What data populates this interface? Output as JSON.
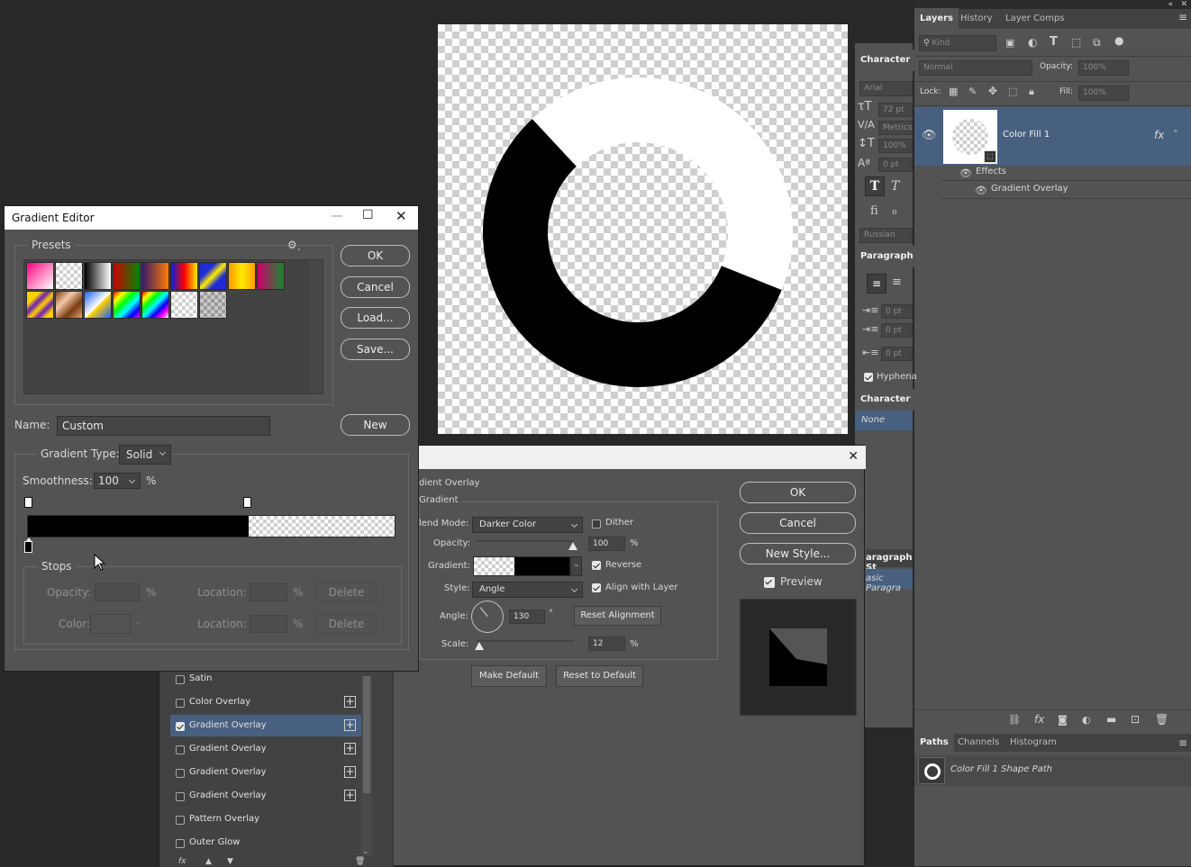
{
  "document": {
    "canvas_label": "canvas"
  },
  "layers_panel": {
    "tabs": [
      "Layers",
      "History",
      "Layer Comps"
    ],
    "filter_kind": "Kind",
    "blend_mode": "Normal",
    "opacity_label": "Opacity:",
    "opacity_value": "100%",
    "lock_label": "Lock:",
    "fill_label": "Fill:",
    "fill_value": "100%",
    "layer_name": "Color Fill 1",
    "fx_badge": "fx",
    "effects_label": "Effects",
    "effect_item": "Gradient Overlay"
  },
  "paths_panel": {
    "tabs": [
      "Paths",
      "Channels",
      "Histogram"
    ],
    "path_name": "Color Fill 1 Shape Path"
  },
  "character_panel": {
    "title": "Character",
    "font_family": "Arial",
    "font_size": "72 pt",
    "kerning": "Metrics",
    "vertical_scale": "100%",
    "baseline": "0 pt",
    "language": "Russian",
    "paragraph_title": "Paragraph",
    "indent_left": "0 pt",
    "indent_first": "0 pt",
    "space_before": "0 pt",
    "hyphenate": "Hyphena",
    "char_styles_title": "Character St",
    "char_style_none": "None",
    "para_styles_title": "aragraph St",
    "para_style_basic": "asic Paragra"
  },
  "layer_style": {
    "section_title": "dient Overlay",
    "subsection": "Gradient",
    "blend_mode_label": "lend Mode:",
    "blend_mode_value": "Darker Color",
    "dither_label": "Dither",
    "opacity_label": "Opacity:",
    "opacity_value": "100",
    "percent": "%",
    "gradient_label": "Gradient:",
    "reverse_label": "Reverse",
    "style_label": "Style:",
    "style_value": "Angle",
    "align_label": "Align with Layer",
    "angle_label": "Angle:",
    "angle_value": "130",
    "degree": "°",
    "reset_alignment": "Reset Alignment",
    "scale_label": "Scale:",
    "scale_value": "12",
    "make_default": "Make Default",
    "reset_default": "Reset to Default",
    "ok": "OK",
    "cancel": "Cancel",
    "new_style": "New Style...",
    "preview_label": "Preview",
    "close": "✕",
    "effects_list": [
      {
        "label": "Satin",
        "checked": false,
        "plus": false
      },
      {
        "label": "Color Overlay",
        "checked": false,
        "plus": true
      },
      {
        "label": "Gradient Overlay",
        "checked": true,
        "plus": true,
        "selected": true
      },
      {
        "label": "Gradient Overlay",
        "checked": false,
        "plus": true
      },
      {
        "label": "Gradient Overlay",
        "checked": false,
        "plus": true
      },
      {
        "label": "Gradient Overlay",
        "checked": false,
        "plus": true
      },
      {
        "label": "Pattern Overlay",
        "checked": false,
        "plus": false
      },
      {
        "label": "Outer Glow",
        "checked": false,
        "plus": false
      }
    ]
  },
  "gradient_editor": {
    "title": "Gradient Editor",
    "presets_label": "Presets",
    "ok": "OK",
    "cancel": "Cancel",
    "load": "Load...",
    "save": "Save...",
    "name_label": "Name:",
    "name_value": "Custom",
    "new": "New",
    "gradient_type_label": "Gradient Type:",
    "gradient_type_value": "Solid",
    "smoothness_label": "Smoothness:",
    "smoothness_value": "100",
    "percent": "%",
    "stops_label": "Stops",
    "opacity_label": "Opacity:",
    "location_label": "Location:",
    "delete_label": "Delete",
    "color_label": "Color:",
    "presets": [
      "linear-gradient(135deg,#ff0080,#fff)",
      "checker",
      "linear-gradient(90deg,#000,#fff)",
      "linear-gradient(90deg,#c00,#080)",
      "linear-gradient(90deg,#3a1b6b,#ff7b00)",
      "linear-gradient(90deg,#0023d8,#ff0000,#ffea00)",
      "linear-gradient(135deg,#1e2bd6 30%,#ffee00 50%,#1e2bd6 70%)",
      "linear-gradient(90deg,#ff9a00,#ffea00,#ff9a00)",
      "linear-gradient(90deg,#d0006f,#138a2c)",
      "linear-gradient(135deg,#ffd000 25%,#6a1fb5 40%,#ffd000 55%,#6a1fb5 70%,#ffd000 85%)",
      "linear-gradient(135deg,#7a3b12,#f3c9a7,#7a3b12,#e0a070)",
      "linear-gradient(135deg,#1a5fff,#fff 50%,#ffd000 55%,#1a5fff)",
      "linear-gradient(135deg,#f00,#ff0,#0f0,#0ff,#00f,#f0f)",
      "linear-gradient(135deg,#f00,#ff0,#0f0,#0ff,#00f,#f0f,#fff)",
      "checker",
      "checker-dark"
    ]
  }
}
